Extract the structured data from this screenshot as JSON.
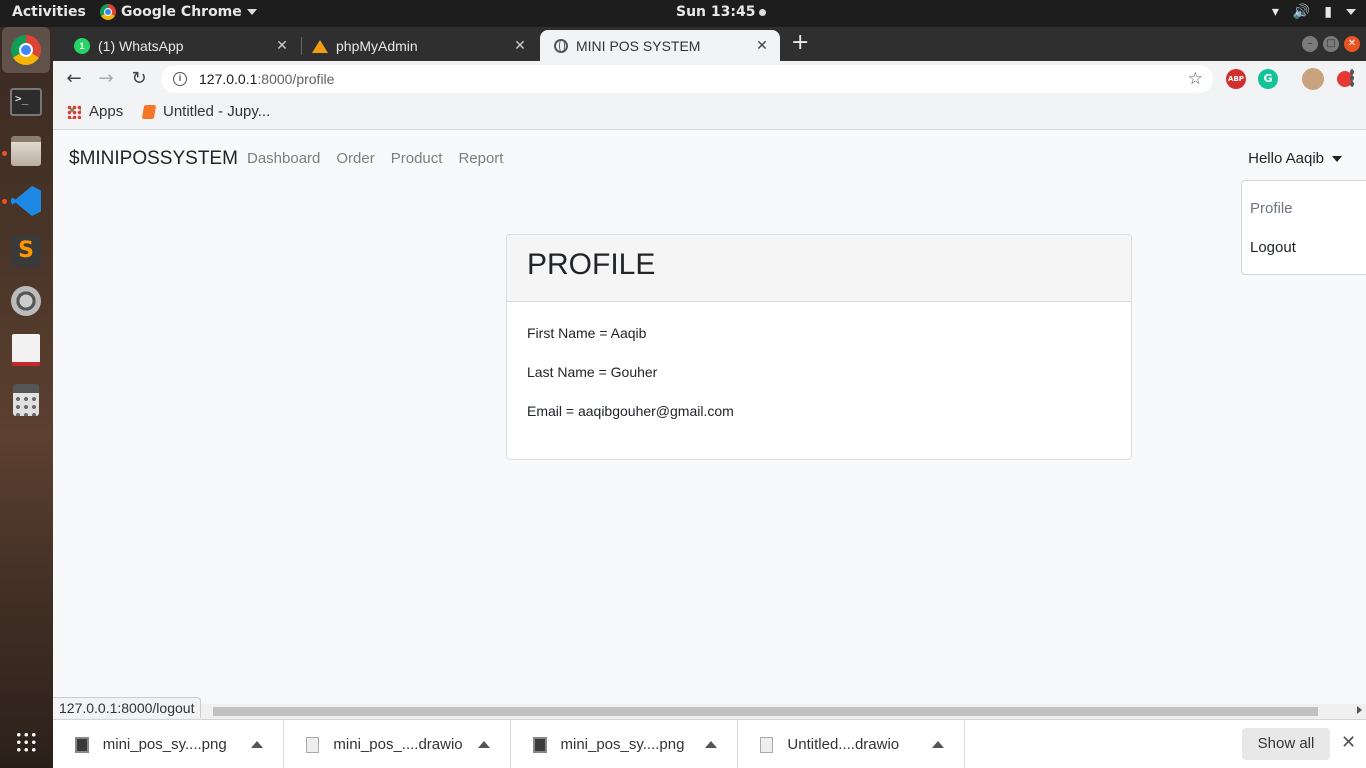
{
  "system": {
    "activities": "Activities",
    "app_menu": "Google Chrome",
    "clock": "Sun 13:45"
  },
  "browser": {
    "tabs": [
      {
        "title": "(1) WhatsApp",
        "favicon": "whatsapp-icon"
      },
      {
        "title": "phpMyAdmin",
        "favicon": "phpmyadmin-icon"
      },
      {
        "title": "MINI POS SYSTEM",
        "favicon": "globe-icon",
        "active": true
      }
    ],
    "url_host": "127.0.0.1",
    "url_path": ":8000/profile",
    "bookmarks": [
      {
        "label": "Apps",
        "icon": "apps-grid-icon"
      },
      {
        "label": "Untitled - Jupy...",
        "icon": "jupyter-icon"
      }
    ],
    "extensions": [
      {
        "name": "adblock-plus-icon",
        "label": "ABP",
        "color": "#d32f2f"
      },
      {
        "name": "grammarly-icon",
        "label": "G",
        "color": "#15c39a"
      },
      {
        "name": "profile-avatar-icon",
        "label": "",
        "color": "#c9a27e"
      },
      {
        "name": "red-extension-icon",
        "label": "",
        "color": "#e53935"
      }
    ]
  },
  "site": {
    "brand": "$MINIPOSSYSTEM",
    "nav": [
      "Dashboard",
      "Order",
      "Product",
      "Report"
    ],
    "user_menu": "Hello Aaqib",
    "dropdown": [
      "Profile",
      "Logout"
    ]
  },
  "profile": {
    "heading": "PROFILE",
    "first_name": "First Name = Aaqib",
    "last_name": "Last Name = Gouher",
    "email": "Email = aaqibgouher@gmail.com"
  },
  "status_url": "127.0.0.1:8000/logout",
  "downloads": [
    {
      "name": "mini_pos_sy....png",
      "type": "png"
    },
    {
      "name": "mini_pos_....drawio",
      "type": "doc"
    },
    {
      "name": "mini_pos_sy....png",
      "type": "png"
    },
    {
      "name": "Untitled....drawio",
      "type": "doc"
    }
  ],
  "shelf": {
    "show_all": "Show all"
  },
  "colors": {
    "accent": "#e95420",
    "page_bg": "#f8f9fa",
    "nav_link": "#7f7f7f"
  }
}
